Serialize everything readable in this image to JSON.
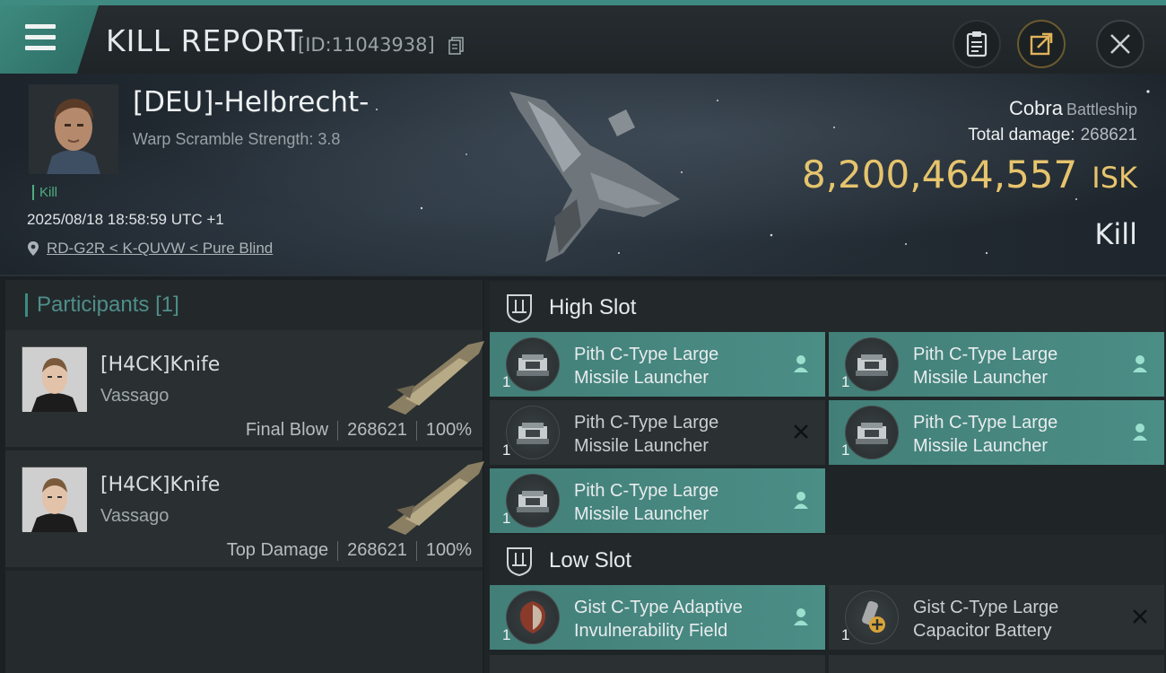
{
  "header": {
    "title": "KILL REPORT",
    "report_id": "[ID:11043938]"
  },
  "victim": {
    "name": "[DEU]-Helbrecht-",
    "warp_scramble": "Warp Scramble Strength: 3.8",
    "kill_tag": "Kill",
    "timestamp": "2025/08/18 18:58:59 UTC +1",
    "location": "RD-G2R < K-QUVW < Pure Blind",
    "ship_name": "Cobra",
    "ship_class": "Battleship",
    "total_damage_label": "Total damage:",
    "total_damage_value": "268621",
    "isk_value": "8,200,464,557",
    "isk_unit": "ISK",
    "result": "Kill"
  },
  "participants": {
    "title": "Participants",
    "count": "[1]",
    "rows": [
      {
        "name": "[H4CK]Knife",
        "ship": "Vassago",
        "role": "Final Blow",
        "damage": "268621",
        "percent": "100%"
      },
      {
        "name": "[H4CK]Knife",
        "ship": "Vassago",
        "role": "Top Damage",
        "damage": "268621",
        "percent": "100%"
      }
    ]
  },
  "slots": {
    "high": {
      "title": "High Slot",
      "modules": [
        {
          "line1": "Pith C-Type Large",
          "line2": "Missile Launcher",
          "qty": "1",
          "status": "dropped"
        },
        {
          "line1": "Pith C-Type Large",
          "line2": "Missile Launcher",
          "qty": "1",
          "status": "dropped"
        },
        {
          "line1": "Pith C-Type Large",
          "line2": "Missile Launcher",
          "qty": "1",
          "status": "destroyed"
        },
        {
          "line1": "Pith C-Type Large",
          "line2": "Missile Launcher",
          "qty": "1",
          "status": "dropped"
        },
        {
          "line1": "Pith C-Type Large",
          "line2": "Missile Launcher",
          "qty": "1",
          "status": "dropped"
        }
      ]
    },
    "low": {
      "title": "Low Slot",
      "modules": [
        {
          "line1": "Gist C-Type Adaptive",
          "line2": "Invulnerability Field",
          "qty": "1",
          "status": "dropped"
        },
        {
          "line1": "Gist C-Type Large",
          "line2": "Capacitor Battery",
          "qty": "1",
          "status": "destroyed"
        }
      ]
    }
  },
  "colors": {
    "accent_teal": "#3f8b82",
    "isk_gold": "#e6c46d",
    "kill_green": "#4fae7f"
  }
}
